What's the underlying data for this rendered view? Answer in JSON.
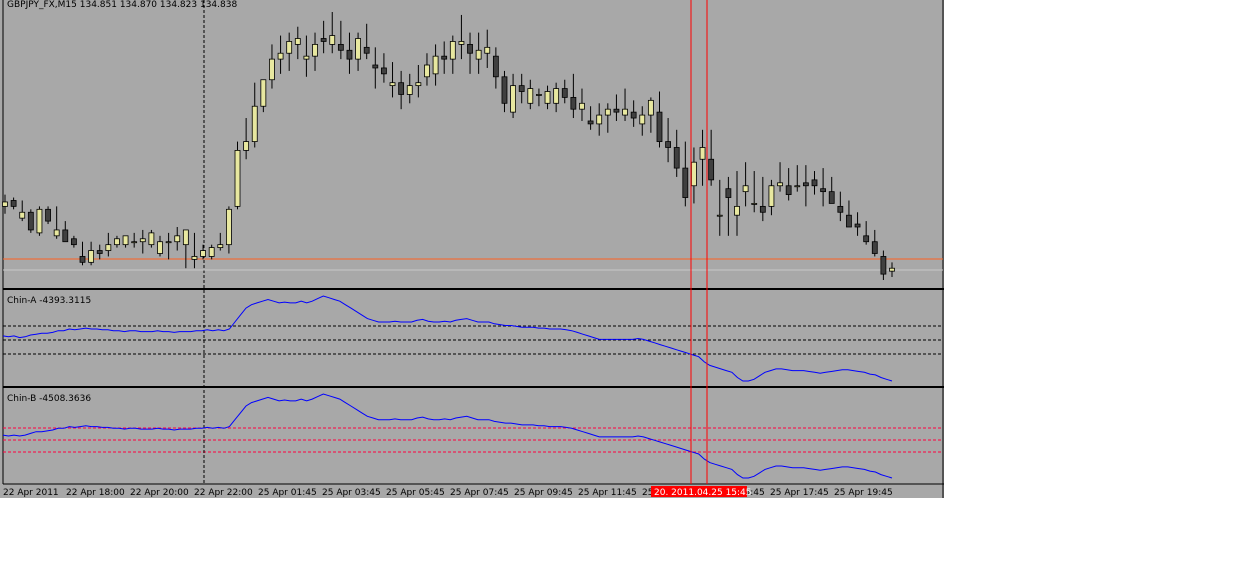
{
  "window": {
    "header": "GBPJPY_FX,M15  134.851 134.870 134.823 134.838"
  },
  "panels": {
    "main": {
      "symbol": "GBPJPY_FX",
      "timeframe": "M15",
      "ohlc": {
        "open": 134.851,
        "high": 134.87,
        "low": 134.823,
        "close": 134.838
      }
    },
    "chin_a": {
      "label": "Chin-A -4393.3115",
      "value": -4393.3115
    },
    "chin_b": {
      "label": "Chin-B -4508.3636",
      "value": -4508.3636
    }
  },
  "time_axis": {
    "labels": [
      "22 Apr 2011",
      "22 Apr 18:00",
      "22 Apr 20:00",
      "22 Apr 22:00",
      "25 Apr 01:45",
      "25 Apr 03:45",
      "25 Apr 05:45",
      "25 Apr 07:45",
      "25 Apr 09:45",
      "25 Apr 11:45",
      "25 Apr 13:45",
      "25 Apr 15:45",
      "25 Apr 17:45",
      "25 Apr 19:45"
    ],
    "crosshair_label": "20. 2011.04.25 15:45"
  },
  "colors": {
    "background": "#a8a8a8",
    "bull_body": "#e8e8a0",
    "bear_body": "#404040",
    "wick": "#000000",
    "indicator_line": "#0000ff",
    "price_level_line": "#ff6020",
    "crosshair": "#ff0000",
    "crosshair_label_bg": "#ff0000",
    "dashed_levels_a": "#000000",
    "dashed_levels_b": "#ff0040"
  },
  "chart_data": [
    {
      "type": "candlestick",
      "series_name": "GBPJPY_FX,M15",
      "candles": [
        [
          60,
          68,
          55,
          63
        ],
        [
          64,
          66,
          58,
          60
        ],
        [
          52,
          64,
          50,
          56
        ],
        [
          56,
          58,
          42,
          44
        ],
        [
          42,
          60,
          40,
          58
        ],
        [
          58,
          60,
          48,
          50
        ],
        [
          40,
          60,
          38,
          44
        ],
        [
          44,
          50,
          36,
          36
        ],
        [
          38,
          40,
          32,
          34
        ],
        [
          26,
          36,
          20,
          22
        ],
        [
          22,
          36,
          20,
          30
        ],
        [
          30,
          34,
          24,
          28
        ],
        [
          30,
          42,
          26,
          34
        ],
        [
          34,
          40,
          32,
          38
        ],
        [
          34,
          40,
          32,
          40
        ],
        [
          36,
          42,
          32,
          36
        ],
        [
          36,
          44,
          28,
          38
        ],
        [
          34,
          44,
          32,
          42
        ],
        [
          28,
          40,
          26,
          36
        ],
        [
          36,
          42,
          24,
          36
        ],
        [
          36,
          46,
          30,
          40
        ],
        [
          34,
          42,
          18,
          44
        ],
        [
          24,
          42,
          18,
          26
        ],
        [
          26,
          34,
          24,
          30
        ],
        [
          26,
          34,
          24,
          32
        ],
        [
          32,
          42,
          30,
          34
        ],
        [
          34,
          60,
          28,
          58
        ],
        [
          60,
          104,
          58,
          98
        ],
        [
          98,
          120,
          92,
          104
        ],
        [
          104,
          144,
          100,
          128
        ],
        [
          128,
          146,
          124,
          146
        ],
        [
          146,
          170,
          140,
          160
        ],
        [
          160,
          176,
          150,
          164
        ],
        [
          164,
          178,
          152,
          172
        ],
        [
          170,
          182,
          160,
          174
        ],
        [
          160,
          176,
          148,
          162
        ],
        [
          162,
          178,
          152,
          170
        ],
        [
          174,
          186,
          164,
          172
        ],
        [
          170,
          192,
          164,
          176
        ],
        [
          170,
          186,
          160,
          166
        ],
        [
          166,
          178,
          150,
          160
        ],
        [
          160,
          178,
          152,
          174
        ],
        [
          168,
          184,
          160,
          164
        ],
        [
          156,
          168,
          140,
          154
        ],
        [
          154,
          164,
          144,
          150
        ],
        [
          142,
          158,
          134,
          144
        ],
        [
          144,
          152,
          126,
          136
        ],
        [
          136,
          150,
          130,
          142
        ],
        [
          142,
          156,
          134,
          144
        ],
        [
          148,
          164,
          142,
          156
        ],
        [
          150,
          170,
          142,
          162
        ],
        [
          162,
          172,
          150,
          160
        ],
        [
          160,
          176,
          150,
          172
        ],
        [
          170,
          190,
          160,
          172
        ],
        [
          170,
          178,
          150,
          164
        ],
        [
          160,
          178,
          150,
          166
        ],
        [
          164,
          180,
          154,
          168
        ],
        [
          162,
          168,
          140,
          148
        ],
        [
          148,
          152,
          124,
          130
        ],
        [
          124,
          150,
          120,
          142
        ],
        [
          142,
          150,
          130,
          138
        ],
        [
          130,
          146,
          126,
          140
        ],
        [
          136,
          140,
          128,
          136
        ],
        [
          130,
          142,
          126,
          138
        ],
        [
          130,
          144,
          124,
          140
        ],
        [
          140,
          146,
          130,
          134
        ],
        [
          134,
          150,
          120,
          126
        ],
        [
          126,
          140,
          118,
          130
        ],
        [
          118,
          128,
          112,
          116
        ],
        [
          116,
          130,
          108,
          122
        ],
        [
          122,
          130,
          110,
          126
        ],
        [
          126,
          136,
          118,
          124
        ],
        [
          122,
          140,
          118,
          126
        ],
        [
          124,
          132,
          114,
          120
        ],
        [
          116,
          128,
          108,
          122
        ],
        [
          122,
          134,
          110,
          132
        ],
        [
          124,
          138,
          100,
          104
        ],
        [
          104,
          120,
          90,
          100
        ],
        [
          100,
          112,
          80,
          86
        ],
        [
          86,
          104,
          60,
          66
        ],
        [
          74,
          100,
          62,
          90
        ],
        [
          92,
          112,
          74,
          100
        ],
        [
          92,
          112,
          74,
          78
        ],
        [
          54,
          78,
          40,
          54
        ],
        [
          72,
          80,
          40,
          66
        ],
        [
          54,
          84,
          40,
          60
        ],
        [
          70,
          90,
          60,
          74
        ],
        [
          62,
          84,
          56,
          62
        ],
        [
          60,
          80,
          50,
          56
        ],
        [
          60,
          78,
          54,
          74
        ],
        [
          74,
          90,
          70,
          76
        ],
        [
          74,
          86,
          64,
          68
        ],
        [
          74,
          88,
          70,
          74
        ],
        [
          76,
          88,
          60,
          74
        ],
        [
          78,
          84,
          68,
          74
        ],
        [
          72,
          86,
          60,
          70
        ],
        [
          70,
          80,
          62,
          62
        ],
        [
          60,
          70,
          50,
          56
        ],
        [
          54,
          64,
          48,
          46
        ],
        [
          48,
          56,
          40,
          46
        ],
        [
          40,
          50,
          34,
          36
        ],
        [
          36,
          44,
          26,
          28
        ],
        [
          26,
          30,
          10,
          14
        ],
        [
          16,
          22,
          12,
          18
        ]
      ],
      "price_axis_note": "values are relative price units read off an unlabeled axis; last candle OHLC 134.851/134.870/134.823/134.838",
      "current_price_line": true
    },
    {
      "type": "line",
      "series_name": "Chin-A",
      "last_value": -4393.3115,
      "values": [
        24,
        23,
        24,
        22,
        23,
        25,
        26,
        27,
        27,
        28,
        30,
        30,
        32,
        31,
        32,
        33,
        32,
        32,
        31,
        31,
        30,
        30,
        29,
        30,
        30,
        29,
        29,
        29,
        30,
        29,
        29,
        28,
        29,
        29,
        29,
        30,
        30,
        31,
        30,
        31,
        30,
        32,
        40,
        48,
        56,
        60,
        62,
        64,
        66,
        64,
        62,
        63,
        62,
        62,
        64,
        62,
        64,
        67,
        70,
        68,
        66,
        64,
        60,
        56,
        52,
        48,
        44,
        42,
        40,
        40,
        40,
        41,
        40,
        40,
        40,
        42,
        43,
        41,
        40,
        40,
        41,
        40,
        42,
        43,
        44,
        42,
        40,
        40,
        40,
        38,
        37,
        36,
        36,
        35,
        34,
        34,
        34,
        33,
        33,
        32,
        32,
        32,
        31,
        30,
        28,
        26,
        24,
        22,
        20,
        20,
        20,
        20,
        20,
        20,
        20,
        21,
        20,
        18,
        16,
        14,
        12,
        10,
        8,
        6,
        4,
        2,
        0,
        -6,
        -10,
        -12,
        -14,
        -16,
        -18,
        -24,
        -28,
        -28,
        -26,
        -22,
        -18,
        -16,
        -14,
        -14,
        -15,
        -16,
        -16,
        -16,
        -17,
        -18,
        -19,
        -18,
        -17,
        -16,
        -15,
        -15,
        -16,
        -17,
        -18,
        -20,
        -21,
        -24,
        -26,
        -28
      ]
    },
    {
      "type": "line",
      "series_name": "Chin-B",
      "last_value": -4508.3636,
      "values": [
        22,
        21,
        22,
        21,
        22,
        24,
        26,
        26,
        27,
        28,
        30,
        30,
        32,
        31,
        32,
        33,
        32,
        32,
        31,
        31,
        30,
        30,
        29,
        30,
        30,
        29,
        29,
        29,
        30,
        29,
        29,
        28,
        29,
        29,
        29,
        30,
        30,
        31,
        30,
        31,
        30,
        32,
        40,
        48,
        56,
        60,
        62,
        64,
        66,
        64,
        62,
        63,
        62,
        62,
        64,
        62,
        64,
        67,
        70,
        68,
        66,
        64,
        60,
        56,
        52,
        48,
        44,
        42,
        40,
        40,
        40,
        41,
        40,
        40,
        40,
        42,
        43,
        41,
        40,
        40,
        41,
        40,
        42,
        43,
        44,
        42,
        40,
        40,
        40,
        38,
        37,
        36,
        36,
        35,
        34,
        34,
        34,
        33,
        33,
        32,
        32,
        32,
        31,
        30,
        28,
        26,
        24,
        22,
        20,
        20,
        20,
        20,
        20,
        20,
        20,
        21,
        20,
        18,
        16,
        14,
        12,
        10,
        8,
        6,
        4,
        2,
        0,
        -6,
        -10,
        -12,
        -14,
        -16,
        -18,
        -24,
        -28,
        -28,
        -26,
        -22,
        -18,
        -16,
        -14,
        -14,
        -15,
        -16,
        -16,
        -16,
        -17,
        -18,
        -19,
        -18,
        -17,
        -16,
        -15,
        -15,
        -16,
        -17,
        -18,
        -20,
        -21,
        -24,
        -26,
        -28
      ]
    }
  ]
}
